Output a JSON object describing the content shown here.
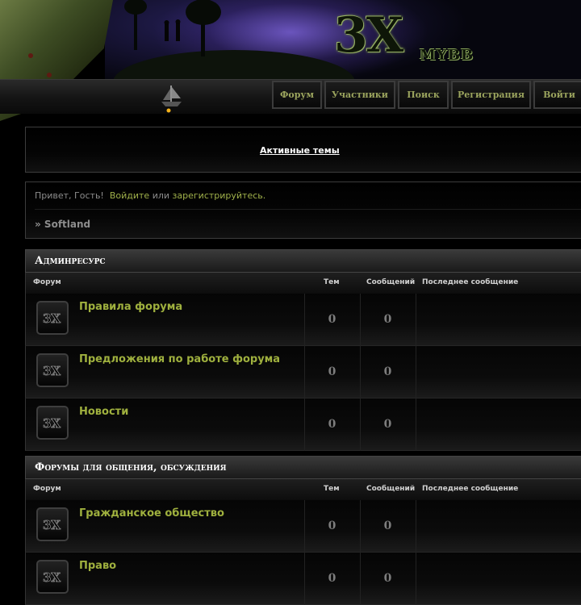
{
  "header": {
    "logo_text": "3X",
    "logo_subtext": "MYBB"
  },
  "nav": [
    {
      "label": "Форум"
    },
    {
      "label": "Участники"
    },
    {
      "label": "Поиск"
    },
    {
      "label": "Регистрация"
    },
    {
      "label": "Войти"
    }
  ],
  "active_topics_label": "Активные темы",
  "welcome": {
    "prefix": "Привет, Гость!",
    "login_link": "Войдите",
    "or_text": "или",
    "register_link": "зарегистрируйтесь."
  },
  "breadcrumb": "» Softland",
  "columns": {
    "forum": "Форум",
    "topics": "Тем",
    "posts": "Сообщений",
    "last_post": "Последнее сообщение"
  },
  "categories": [
    {
      "title": "Админресурс",
      "forums": [
        {
          "name": "Правила форума",
          "topics": "0",
          "posts": "0",
          "last_post": ""
        },
        {
          "name": "Предложения по работе форума",
          "topics": "0",
          "posts": "0",
          "last_post": ""
        },
        {
          "name": "Новости",
          "topics": "0",
          "posts": "0",
          "last_post": ""
        }
      ]
    },
    {
      "title": "Форумы для общения, обсуждения",
      "forums": [
        {
          "name": "Гражданское общество",
          "topics": "0",
          "posts": "0",
          "last_post": ""
        },
        {
          "name": "Право",
          "topics": "0",
          "posts": "0",
          "last_post": ""
        }
      ]
    }
  ],
  "colors": {
    "accent_green": "#9fb03e",
    "nav_text": "#9aa35d",
    "background": "#000000"
  }
}
